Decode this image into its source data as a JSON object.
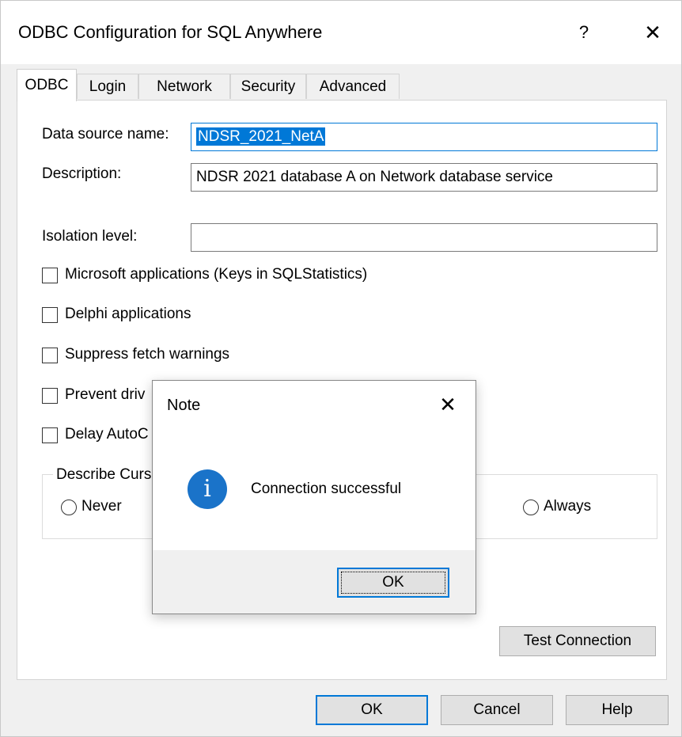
{
  "window": {
    "title": "ODBC Configuration for SQL Anywhere",
    "help_glyph": "?",
    "close_glyph": "✕"
  },
  "tabs": [
    {
      "label": "ODBC",
      "active": true
    },
    {
      "label": "Login",
      "active": false
    },
    {
      "label": "Network",
      "active": false
    },
    {
      "label": "Security",
      "active": false
    },
    {
      "label": "Advanced",
      "active": false
    }
  ],
  "form": {
    "data_source_name_label": "Data source name:",
    "data_source_name_value": "NDSR_2021_NetA",
    "description_label": "Description:",
    "description_value": "NDSR 2021 database A on Network database service",
    "isolation_level_label": "Isolation level:",
    "isolation_level_value": ""
  },
  "checkboxes": [
    {
      "label": "Microsoft applications (Keys in SQLStatistics)",
      "checked": false
    },
    {
      "label": "Delphi applications",
      "checked": false
    },
    {
      "label": "Suppress fetch warnings",
      "checked": false
    },
    {
      "label": "Prevent driv",
      "checked": false
    },
    {
      "label": "Delay AutoC",
      "checked": false
    }
  ],
  "describe_cursor": {
    "group_label": "Describe Curs",
    "options": [
      {
        "label": "Never",
        "selected": false
      },
      {
        "label": "Always",
        "selected": false
      }
    ]
  },
  "buttons": {
    "test_connection": "Test Connection",
    "ok": "OK",
    "cancel": "Cancel",
    "help": "Help"
  },
  "note_dialog": {
    "title": "Note",
    "close_glyph": "✕",
    "icon": "info-icon",
    "message": "Connection successful",
    "ok": "OK"
  },
  "colors": {
    "accent": "#0078d7",
    "info_icon": "#1a73c9",
    "window_bg": "#f0f0f0"
  }
}
